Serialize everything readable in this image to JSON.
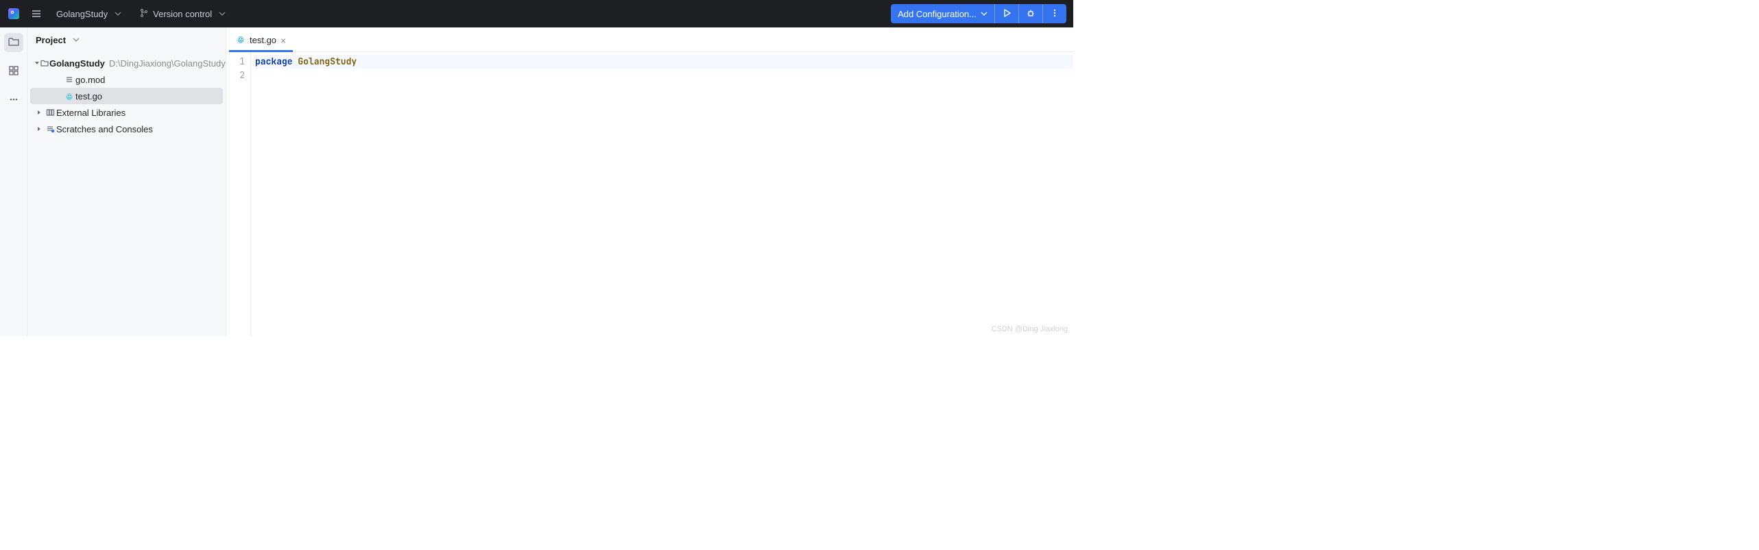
{
  "navbar": {
    "project_name": "GolangStudy",
    "vcs_label": "Version control",
    "run_config_label": "Add Configuration..."
  },
  "sidebar": {
    "title": "Project",
    "root": {
      "name": "GolangStudy",
      "path": "D:\\DingJiaxiong\\GolangStudy"
    },
    "files": [
      {
        "name": "go.mod",
        "icon": "lines"
      },
      {
        "name": "test.go",
        "icon": "gopher",
        "selected": true
      }
    ],
    "extra": [
      {
        "name": "External Libraries",
        "icon": "lib"
      },
      {
        "name": "Scratches and Consoles",
        "icon": "scratch"
      }
    ]
  },
  "tabs": [
    {
      "name": "test.go",
      "icon": "gopher",
      "active": true
    }
  ],
  "code": {
    "lines": [
      {
        "n": 1,
        "tokens": [
          {
            "t": "package ",
            "c": "kw"
          },
          {
            "t": "GolangStudy",
            "c": "pkg"
          }
        ]
      },
      {
        "n": 2,
        "tokens": []
      }
    ]
  },
  "watermark": "CSDN @Ding Jiaxiong"
}
